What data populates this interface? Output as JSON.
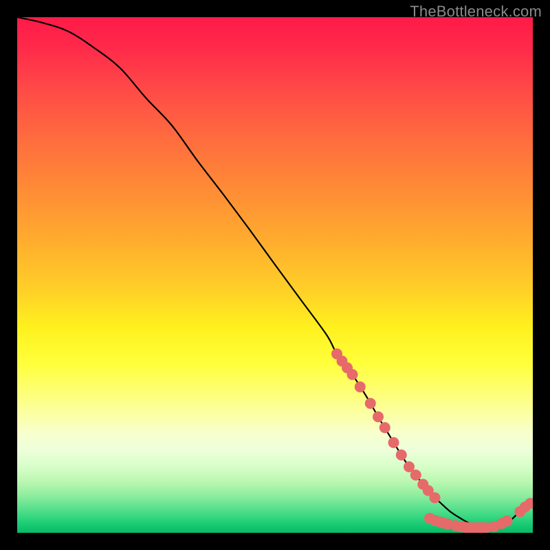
{
  "attribution": "TheBottleneck.com",
  "chart_data": {
    "type": "line",
    "title": "",
    "xlabel": "",
    "ylabel": "",
    "xlim": [
      0,
      100
    ],
    "ylim": [
      0,
      100
    ],
    "series": [
      {
        "name": "curve",
        "x": [
          0,
          5,
          10,
          15,
          20,
          25,
          30,
          35,
          40,
          45,
          50,
          55,
          60,
          62,
          65,
          68,
          70,
          72,
          74,
          76,
          78,
          80,
          82,
          84,
          86,
          88,
          90,
          92,
          94,
          96,
          98,
          100
        ],
        "values": [
          100.0,
          98.9,
          97.2,
          94.0,
          90.1,
          84.3,
          79.0,
          72.1,
          65.6,
          58.9,
          52.0,
          45.2,
          38.4,
          34.7,
          30.7,
          26.0,
          22.5,
          19.2,
          15.9,
          12.8,
          10.3,
          7.8,
          5.9,
          4.1,
          2.8,
          1.7,
          1.1,
          0.8,
          1.2,
          2.7,
          4.7,
          6.1
        ]
      }
    ],
    "markers": {
      "name": "dots",
      "color": "#e66a6a",
      "radius": 8,
      "points": [
        {
          "x": 62.0,
          "y": 34.7
        },
        {
          "x": 63.0,
          "y": 33.3
        },
        {
          "x": 64.0,
          "y": 32.0
        },
        {
          "x": 65.0,
          "y": 30.7
        },
        {
          "x": 66.5,
          "y": 28.3
        },
        {
          "x": 68.5,
          "y": 25.1
        },
        {
          "x": 70.0,
          "y": 22.5
        },
        {
          "x": 71.3,
          "y": 20.4
        },
        {
          "x": 73.0,
          "y": 17.5
        },
        {
          "x": 74.5,
          "y": 15.1
        },
        {
          "x": 76.0,
          "y": 12.8
        },
        {
          "x": 77.3,
          "y": 11.2
        },
        {
          "x": 78.7,
          "y": 9.4
        },
        {
          "x": 79.7,
          "y": 8.2
        },
        {
          "x": 81.0,
          "y": 6.8
        },
        {
          "x": 80.0,
          "y": 2.8
        },
        {
          "x": 81.0,
          "y": 2.4
        },
        {
          "x": 82.0,
          "y": 2.1
        },
        {
          "x": 82.7,
          "y": 1.9
        },
        {
          "x": 83.5,
          "y": 1.7
        },
        {
          "x": 85.0,
          "y": 1.4
        },
        {
          "x": 86.0,
          "y": 1.2
        },
        {
          "x": 86.7,
          "y": 1.1
        },
        {
          "x": 87.2,
          "y": 1.0
        },
        {
          "x": 88.0,
          "y": 1.0
        },
        {
          "x": 89.0,
          "y": 1.0
        },
        {
          "x": 89.7,
          "y": 1.0
        },
        {
          "x": 90.3,
          "y": 1.0
        },
        {
          "x": 91.0,
          "y": 1.0
        },
        {
          "x": 92.5,
          "y": 1.2
        },
        {
          "x": 94.0,
          "y": 1.8
        },
        {
          "x": 95.0,
          "y": 2.3
        },
        {
          "x": 97.5,
          "y": 4.1
        },
        {
          "x": 98.5,
          "y": 5.0
        },
        {
          "x": 99.5,
          "y": 5.7
        }
      ]
    }
  }
}
